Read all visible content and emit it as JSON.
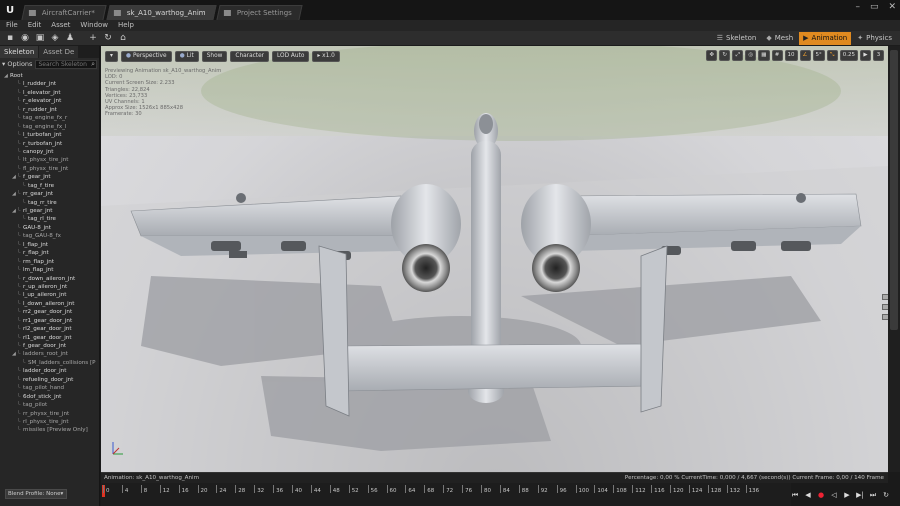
{
  "window": {
    "tabs": [
      {
        "label": "AircraftCarrier*",
        "active": false
      },
      {
        "label": "sk_A10_warthog_Anim",
        "active": true
      },
      {
        "label": "Project Settings",
        "active": false
      }
    ]
  },
  "menu": [
    "File",
    "Edit",
    "Asset",
    "Window",
    "Help"
  ],
  "modes": [
    {
      "label": "Skeleton",
      "icon": "skeleton-icon",
      "active": false
    },
    {
      "label": "Mesh",
      "icon": "mesh-icon",
      "active": false
    },
    {
      "label": "Animation",
      "icon": "animation-icon",
      "active": true
    },
    {
      "label": "Physics",
      "icon": "physics-icon",
      "active": false
    }
  ],
  "sidebar": {
    "tabs": [
      {
        "label": "Skeleton",
        "active": true
      },
      {
        "label": "Asset De",
        "active": false
      }
    ],
    "options_label": "Options",
    "search_placeholder": "Search Skeleton",
    "tree": [
      {
        "label": "Root",
        "depth": 0,
        "expanded": true,
        "tag": false
      },
      {
        "label": "l_rudder_jnt",
        "depth": 1,
        "tag": false
      },
      {
        "label": "l_elevator_jnt",
        "depth": 1,
        "tag": false
      },
      {
        "label": "r_elevator_jnt",
        "depth": 1,
        "tag": false
      },
      {
        "label": "r_rudder_jnt",
        "depth": 1,
        "tag": false
      },
      {
        "label": "tag_engine_fx_r",
        "depth": 1,
        "tag": true
      },
      {
        "label": "tag_engine_fx_l",
        "depth": 1,
        "tag": true
      },
      {
        "label": "l_turbofan_jnt",
        "depth": 1,
        "tag": false
      },
      {
        "label": "r_turbofan_jnt",
        "depth": 1,
        "tag": false
      },
      {
        "label": "canopy_jnt",
        "depth": 1,
        "tag": false
      },
      {
        "label": "lt_physx_tire_jnt",
        "depth": 1,
        "tag": true
      },
      {
        "label": "fl_physx_tire_jnt",
        "depth": 1,
        "tag": true
      },
      {
        "label": "f_gear_jnt",
        "depth": 1,
        "expanded": true,
        "tag": false
      },
      {
        "label": "tag_f_tire",
        "depth": 2,
        "tag": false
      },
      {
        "label": "rr_gear_jnt",
        "depth": 1,
        "expanded": true,
        "tag": false
      },
      {
        "label": "tag_rr_tire",
        "depth": 2,
        "tag": false
      },
      {
        "label": "rl_gear_jnt",
        "depth": 1,
        "expanded": true,
        "tag": false
      },
      {
        "label": "tag_rl_tire",
        "depth": 2,
        "tag": false
      },
      {
        "label": "GAU-8_jnt",
        "depth": 1,
        "tag": false
      },
      {
        "label": "tag_GAU-8_fx",
        "depth": 1,
        "tag": true
      },
      {
        "label": "l_flap_jnt",
        "depth": 1,
        "tag": false
      },
      {
        "label": "r_flap_jnt",
        "depth": 1,
        "tag": false
      },
      {
        "label": "rm_flap_jnt",
        "depth": 1,
        "tag": false
      },
      {
        "label": "lm_flap_jnt",
        "depth": 1,
        "tag": false
      },
      {
        "label": "r_down_aileron_jnt",
        "depth": 1,
        "tag": false
      },
      {
        "label": "r_up_aileron_jnt",
        "depth": 1,
        "tag": false
      },
      {
        "label": "l_up_aileron_jnt",
        "depth": 1,
        "tag": false
      },
      {
        "label": "l_down_aileron_jnt",
        "depth": 1,
        "tag": false
      },
      {
        "label": "rr2_gear_door_jnt",
        "depth": 1,
        "tag": false
      },
      {
        "label": "rr1_gear_door_jnt",
        "depth": 1,
        "tag": false
      },
      {
        "label": "rl2_gear_door_jnt",
        "depth": 1,
        "tag": false
      },
      {
        "label": "rl1_gear_door_jnt",
        "depth": 1,
        "tag": false
      },
      {
        "label": "f_gear_door_jnt",
        "depth": 1,
        "tag": false
      },
      {
        "label": "ladders_root_jnt",
        "depth": 1,
        "expanded": true,
        "tag": true
      },
      {
        "label": "SM_ladders_collisions [P",
        "depth": 2,
        "tag": true
      },
      {
        "label": "ladder_door_jnt",
        "depth": 1,
        "tag": false
      },
      {
        "label": "refueling_door_jnt",
        "depth": 1,
        "tag": false
      },
      {
        "label": "tag_pilot_hand",
        "depth": 1,
        "tag": true
      },
      {
        "label": "6dof_stick_jnt",
        "depth": 1,
        "tag": false
      },
      {
        "label": "tag_pilot",
        "depth": 1,
        "tag": true
      },
      {
        "label": "rr_physx_tire_jnt",
        "depth": 1,
        "tag": true
      },
      {
        "label": "rl_physx_tire_jnt",
        "depth": 1,
        "tag": true
      },
      {
        "label": "missiles [Preview Only]",
        "depth": 1,
        "tag": true
      }
    ],
    "blend_profile": "Blend Profile: None"
  },
  "viewport": {
    "buttons": [
      "Perspective",
      "Lit",
      "Show",
      "Character",
      "LOD Auto",
      "x1.0"
    ],
    "right_values": [
      "10",
      "5°",
      "0.25",
      "3"
    ],
    "info": [
      "Previewing Animation sk_A10_warthog_Anim",
      "LOD: 0",
      "Current Screen Size: 2.233",
      "Triangles: 22,824",
      "Vertices: 23,733",
      "UV Channels: 1",
      "Approx Size: 1526x1 885x428",
      "Framerate: 30"
    ]
  },
  "anim_bar": {
    "label": "Animation: sk_A10_warthog_Anim",
    "status": "Percentage: 0,00 % CurrentTime: 0,000 / 4,667 (second(s)) Current Frame: 0,00 / 140 Frame"
  },
  "timeline": {
    "ticks": [
      "0",
      "4",
      "8",
      "12",
      "16",
      "20",
      "24",
      "28",
      "32",
      "36",
      "40",
      "44",
      "48",
      "52",
      "56",
      "60",
      "64",
      "68",
      "72",
      "76",
      "80",
      "84",
      "88",
      "92",
      "96",
      "100",
      "104",
      "108",
      "112",
      "116",
      "120",
      "124",
      "128",
      "132",
      "136"
    ],
    "current_frame": 0,
    "max_frame": 140
  },
  "colors": {
    "accent": "#e08a20",
    "playhead": "#dd3322"
  }
}
